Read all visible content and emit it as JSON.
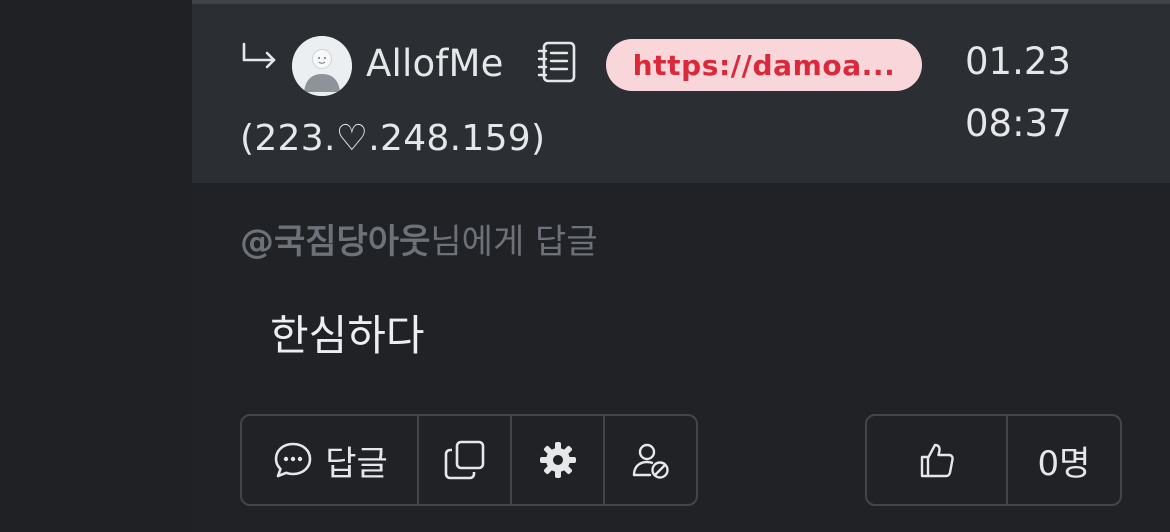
{
  "comment": {
    "author": "AllofMe",
    "link": "https://damoa...",
    "ip": "(223.♡.248.159)",
    "date": "01.23",
    "time": "08:37",
    "reply_target": "@국짐당아웃",
    "reply_suffix": "님에게 답글",
    "body": "한심하다"
  },
  "actions": {
    "reply_label": "답글",
    "like_count": "0명"
  },
  "icons": [
    "reply-arrow-icon",
    "avatar",
    "memo-icon",
    "comment-bubble-icon",
    "copy-icon",
    "gear-icon",
    "user-block-icon",
    "thumbs-up-icon"
  ],
  "colors": {
    "background": "#202226",
    "header_bg": "#2b2f34",
    "pill_bg": "#f8d6da",
    "pill_text": "#d9293b",
    "muted_text": "#6d7178"
  }
}
